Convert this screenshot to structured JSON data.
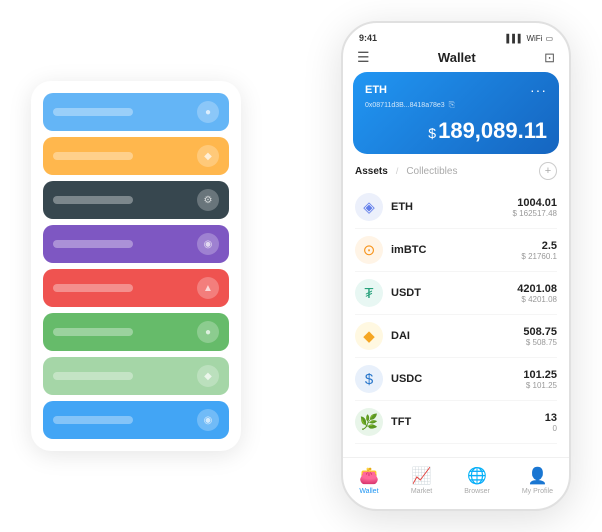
{
  "scene": {
    "cards": [
      {
        "color": "card-blue",
        "label": "",
        "icon": "●"
      },
      {
        "color": "card-orange",
        "label": "",
        "icon": "◆"
      },
      {
        "color": "card-dark",
        "label": "",
        "icon": "⚙"
      },
      {
        "color": "card-purple",
        "label": "",
        "icon": "◉"
      },
      {
        "color": "card-red",
        "label": "",
        "icon": "▲"
      },
      {
        "color": "card-green",
        "label": "",
        "icon": "●"
      },
      {
        "color": "card-light-green",
        "label": "",
        "icon": "◆"
      },
      {
        "color": "card-sky",
        "label": "",
        "icon": "◉"
      }
    ]
  },
  "phone": {
    "status": {
      "time": "9:41",
      "signal": "▌▌▌",
      "wifi": "WiFi",
      "battery": "⬜"
    },
    "header": {
      "menu_icon": "☰",
      "title": "Wallet",
      "scan_icon": "⊡"
    },
    "eth_card": {
      "label": "ETH",
      "address": "0x08711d3B...8418a78e3",
      "copy_icon": "⎘",
      "dots": "···",
      "balance_prefix": "$",
      "balance": "189,089.11"
    },
    "tabs": {
      "active": "Assets",
      "divider": "/",
      "inactive": "Collectibles",
      "add_icon": "+"
    },
    "assets": [
      {
        "name": "ETH",
        "icon": "◈",
        "icon_color": "#627eea",
        "amount": "1004.01",
        "usd": "$ 162517.48"
      },
      {
        "name": "imBTC",
        "icon": "⊙",
        "icon_color": "#f7931a",
        "amount": "2.5",
        "usd": "$ 21760.1"
      },
      {
        "name": "USDT",
        "icon": "₮",
        "icon_color": "#26a17b",
        "amount": "4201.08",
        "usd": "$ 4201.08"
      },
      {
        "name": "DAI",
        "icon": "◈",
        "icon_color": "#f5a623",
        "amount": "508.75",
        "usd": "$ 508.75"
      },
      {
        "name": "USDC",
        "icon": "$",
        "icon_color": "#2775ca",
        "amount": "101.25",
        "usd": "$ 101.25"
      },
      {
        "name": "TFT",
        "icon": "🌿",
        "icon_color": "#4caf50",
        "amount": "13",
        "usd": "0"
      }
    ],
    "nav": [
      {
        "icon": "👛",
        "label": "Wallet",
        "active": true
      },
      {
        "icon": "📈",
        "label": "Market",
        "active": false
      },
      {
        "icon": "🌐",
        "label": "Browser",
        "active": false
      },
      {
        "icon": "👤",
        "label": "My Profile",
        "active": false
      }
    ]
  }
}
